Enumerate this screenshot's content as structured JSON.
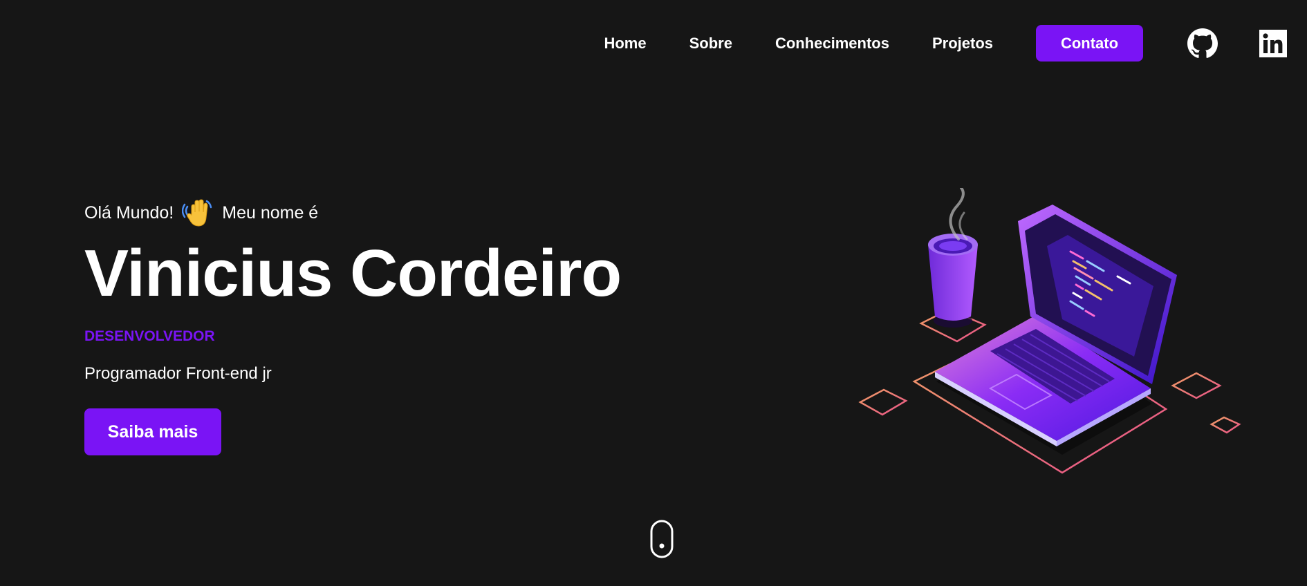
{
  "nav": {
    "links": [
      "Home",
      "Sobre",
      "Conhecimentos",
      "Projetos"
    ],
    "cta": "Contato",
    "social": [
      "github-icon",
      "linkedin-icon"
    ]
  },
  "hero": {
    "greeting_before": "Olá Mundo!",
    "greeting_after": "Meu nome é",
    "name": "Vinicius Cordeiro",
    "role": "DESENVOLVEDOR",
    "description": "Programador Front-end jr",
    "cta": "Saiba mais"
  },
  "colors": {
    "background": "#161616",
    "accent": "#7a14f5",
    "text": "#ffffff"
  },
  "icons": {
    "wave": "waving-hand-icon",
    "scroll": "mouse-scroll-icon"
  }
}
